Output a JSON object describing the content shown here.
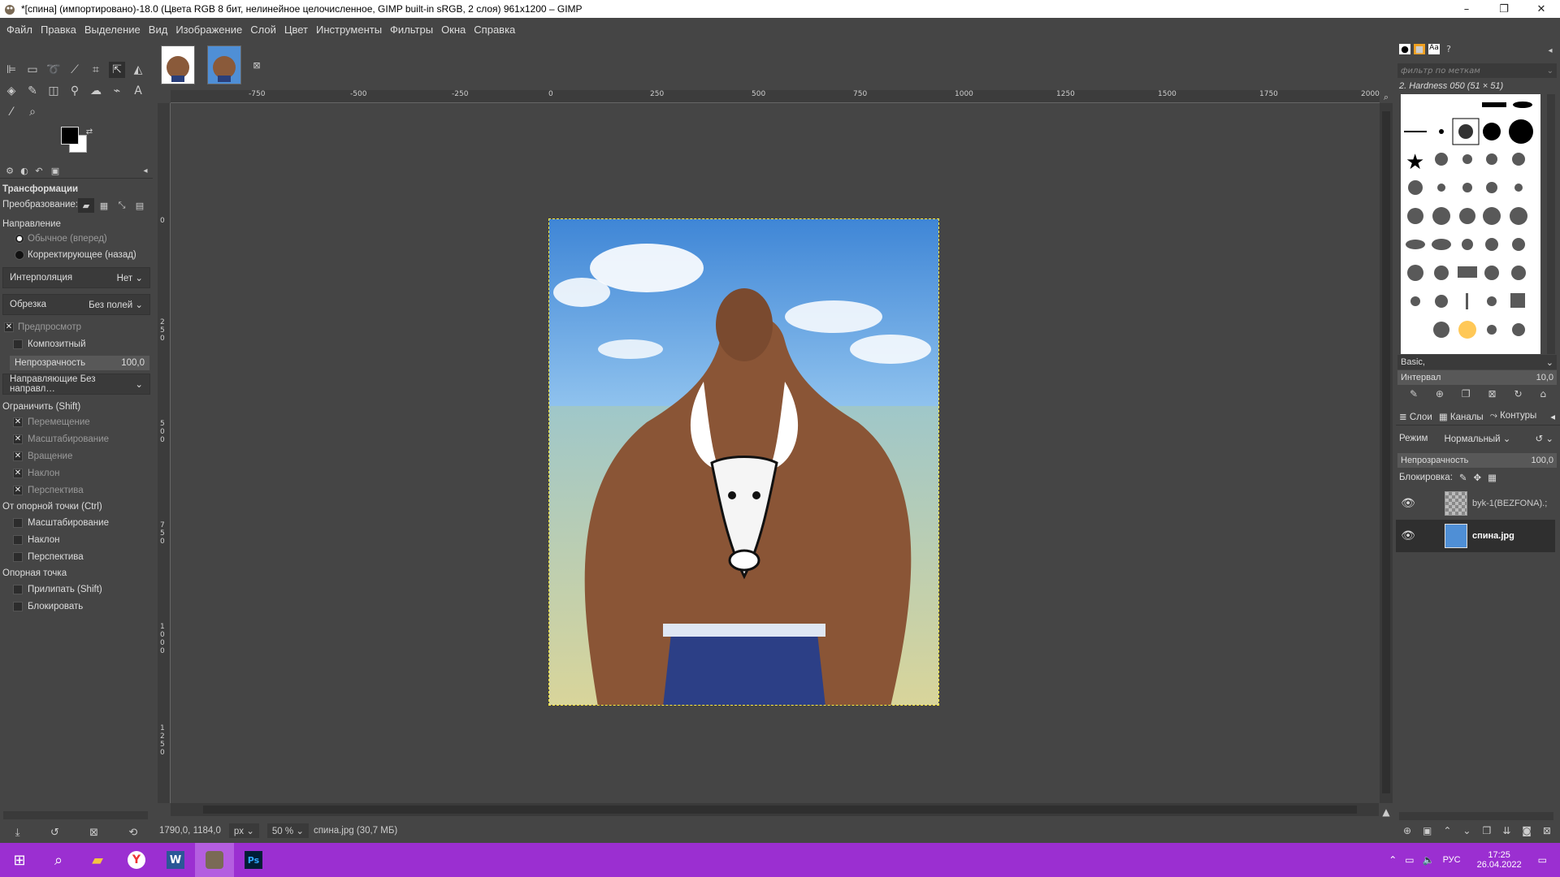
{
  "window": {
    "title": "*[спина] (импортировано)-18.0 (Цвета RGB 8 бит, нелинейное целочисленное, GIMP built-in sRGB, 2 слоя) 961x1200 – GIMP",
    "minimize": "–",
    "maximize": "❐",
    "close": "✕"
  },
  "menu": [
    "Файл",
    "Правка",
    "Выделение",
    "Вид",
    "Изображение",
    "Слой",
    "Цвет",
    "Инструменты",
    "Фильтры",
    "Окна",
    "Справка"
  ],
  "toolopts": {
    "title": "Трансформации",
    "transform_label": "Преобразование:",
    "direction_label": "Направление",
    "dir_normal": "Обычное (вперед)",
    "dir_corrective": "Корректирующее (назад)",
    "interp_label": "Интерполяция",
    "interp_value": "Нет",
    "clip_label": "Обрезка",
    "clip_value": "Без полей",
    "preview": "Предпросмотр",
    "composite": "Композитный",
    "opacity_label": "Непрозрачность",
    "opacity_value": "100,0",
    "guides": "Направляющие Без направл…",
    "constrain_label": "Ограничить (Shift)",
    "c_move": "Перемещение",
    "c_scale": "Масштабирование",
    "c_rotate": "Вращение",
    "c_shear": "Наклон",
    "c_persp": "Перспектива",
    "pivot_label": "От опорной точки  (Ctrl)",
    "p_scale": "Масштабирование",
    "p_shear": "Наклон",
    "p_persp": "Перспектива",
    "anchor_label": "Опорная точка",
    "snap": "Прилипать (Shift)",
    "lock": "Блокировать"
  },
  "ruler": {
    "h": [
      "-750",
      "-500",
      "-250",
      "0",
      "250",
      "500",
      "750",
      "1000",
      "1250",
      "1500",
      "1750",
      "2000"
    ],
    "v": [
      "0",
      "2 5 0",
      "5 0 0",
      "7 5 0",
      "1 0 0 0",
      "1 2 5 0"
    ]
  },
  "status": {
    "coords": "1790,0, 1184,0",
    "unit": "px",
    "zoom": "50 %",
    "info": "спина.jpg (30,7 МБ)"
  },
  "brushes": {
    "filter_placeholder": "фильтр по меткам",
    "current": "2. Hardness 050 (51 × 51)",
    "preset": "Basic,",
    "spacing_label": "Интервал",
    "spacing_value": "10,0"
  },
  "layers": {
    "tabs": [
      "Слои",
      "Каналы",
      "Контуры"
    ],
    "mode_label": "Режим",
    "mode_value": "Нормальный",
    "opacity_label": "Непрозрачность",
    "opacity_value": "100,0",
    "lock_label": "Блокировка:",
    "items": [
      {
        "name": "byk-1(BEZFONA).;"
      },
      {
        "name": "спина.jpg"
      }
    ]
  },
  "taskbar": {
    "lang": "РУС",
    "time": "17:25",
    "date": "26.04.2022"
  },
  "colors": {
    "taskbar": "#9b2fd1",
    "panel": "#454545",
    "selection": "#ffeb3b"
  }
}
